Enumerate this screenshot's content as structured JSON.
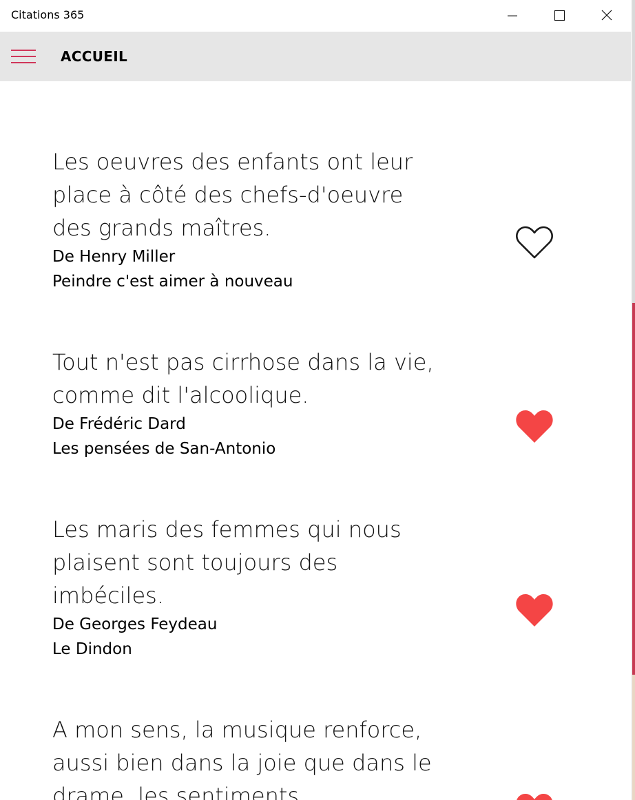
{
  "window": {
    "title": "Citations 365",
    "minimize_icon": "minimize-icon",
    "maximize_icon": "maximize-icon",
    "close_icon": "close-icon"
  },
  "header": {
    "menu_icon": "hamburger-menu-icon",
    "title": "ACCUEIL",
    "accent_color": "#d0375a",
    "background": "#e6e6e6"
  },
  "quotes": [
    {
      "text": "Les oeuvres des enfants ont leur place à côté des chefs-d'oeuvre des grands maîtres.",
      "author": "De Henry Miller",
      "source": "Peindre c'est aimer à nouveau",
      "favorite": false
    },
    {
      "text": "Tout n'est pas cirrhose dans la vie, comme dit l'alcoolique.",
      "author": "De Frédéric Dard",
      "source": "Les pensées de San-Antonio",
      "favorite": true
    },
    {
      "text": "Les maris des femmes qui nous plaisent sont toujours des imbéciles.",
      "author": "De Georges Feydeau",
      "source": "Le Dindon",
      "favorite": true
    },
    {
      "text": "A mon sens, la musique renforce, aussi bien dans la joie que dans le drame, les sentiments",
      "author": "",
      "source": "",
      "favorite": true
    }
  ],
  "colors": {
    "heart_filled": "#f44545",
    "heart_outline": "#1a1a1a"
  }
}
